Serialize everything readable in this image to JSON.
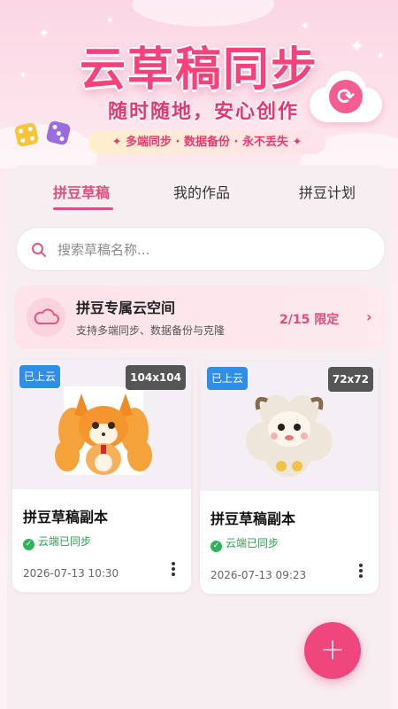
{
  "banner": {
    "title": "云草稿同步",
    "subtitle": "随时随地，安心创作",
    "tagline": "✦ 多端同步 · 数据备份 · 永不丢失 ✦"
  },
  "tabs": [
    {
      "label": "拼豆草稿",
      "active": true
    },
    {
      "label": "我的作品",
      "active": false
    },
    {
      "label": "拼豆计划",
      "active": false
    }
  ],
  "search": {
    "placeholder": "搜索草稿名称...",
    "value": ""
  },
  "cloud_space": {
    "title": "拼豆专属云空间",
    "description": "支持多端同步、数据备份与克隆",
    "quota": "2/15 限定",
    "chevron": "›"
  },
  "drafts": [
    {
      "badge": "已上云",
      "size": "104x104",
      "title": "拼豆草稿副本",
      "sync_status": "云端已同步",
      "date": "2026-07-13 10:30",
      "thumbnail_icon": "fox-pixel-art"
    },
    {
      "badge": "已上云",
      "size": "72x72",
      "title": "拼豆草稿副本",
      "sync_status": "云端已同步",
      "date": "2026-07-13 09:23",
      "thumbnail_icon": "sheep-pixel-art"
    }
  ],
  "fab": {
    "label": "+"
  },
  "colors": {
    "accent": "#e84a7a",
    "fab": "#f0467e",
    "badge_blue": "#2f8ee8",
    "sync_green": "#27a24a"
  }
}
